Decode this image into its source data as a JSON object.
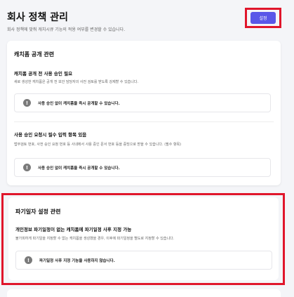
{
  "header": {
    "title": "회사 정책 관리",
    "subtitle": "회사 정책에 맞춰 캐치시큐 기능의 적용 여부를 변경할 수 있습니다.",
    "setting_button": "설정"
  },
  "sections": [
    {
      "title": "캐치폼 공개 관련",
      "items": [
        {
          "title": "캐치폼 공개 전 사용 승인 필요",
          "description": "새로 생성한 캐치폼은 공개 전 보안 담당자의 사전 검토를 받도록 강제할 수 있습니다.",
          "status": "사용 승인 없이 캐치폼을 즉시 공개할 수 있습니다."
        },
        {
          "title": "사용 승인 요청시 필수 입력 항목 있음",
          "description": "법무검토 번호, 사전 승인 요청 번호 등 사내에서 사용 중인 문서 번호 등을 증빙으로 받을 수 있습니다. (필수 항목)",
          "status": "사용 승인 없이 캐치폼을 즉시 공개할 수 있습니다."
        }
      ]
    },
    {
      "title": "파기일자 설정 관련",
      "items": [
        {
          "title": "개인정보 파기일정이 없는 캐치폼에 파기일정 사후 지정 가능",
          "description": "불가피하게 파기일을 지정할 수 없는 캐치폼을 생성했을 경우, 이후에 파기일정을 별도로 지정할 수 있습니다.",
          "status": "파기일정 사후 지정 기능을 사용하지 않습니다."
        }
      ]
    }
  ],
  "icons": {
    "status": "info-icon"
  },
  "colors": {
    "accent": "#5a57e8",
    "highlight": "#e0162b"
  }
}
